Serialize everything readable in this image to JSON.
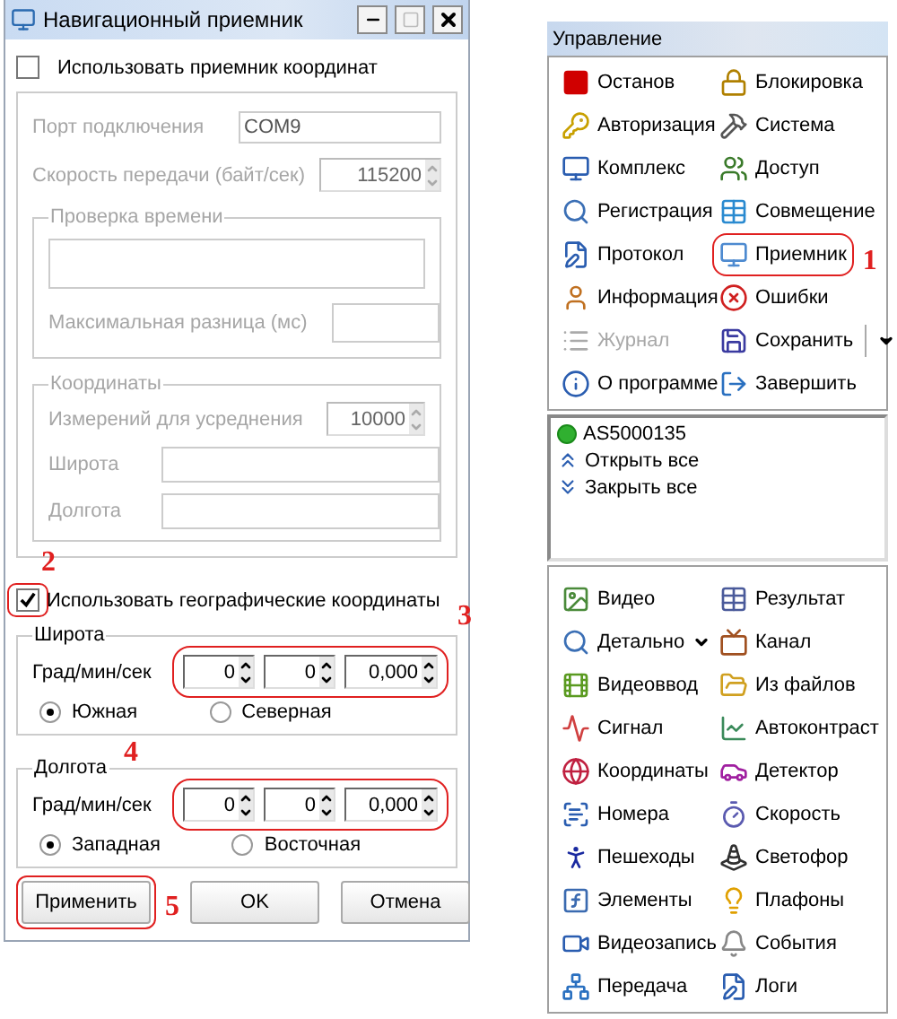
{
  "window": {
    "title": "Навигационный приемник"
  },
  "use_receiver": {
    "label": "Использовать приемник координат",
    "checked": false
  },
  "receiver": {
    "disabled": true,
    "port": {
      "label": "Порт подключения",
      "value": "COM9"
    },
    "speed": {
      "label": "Скорость передачи (байт/сек)",
      "value": "115200"
    },
    "time_check": {
      "title": "Проверка времени",
      "max_diff": {
        "label": "Максимальная разница (мс)"
      }
    },
    "coordinates": {
      "title": "Координаты",
      "averaging": {
        "label": "Измерений для усреднения",
        "value": "10000"
      },
      "latitude": {
        "label": "Широта"
      },
      "longitude": {
        "label": "Долгота"
      }
    }
  },
  "use_geo": {
    "label": "Использовать географические координаты",
    "checked": true,
    "highlighted": true,
    "callout": "2"
  },
  "geo_groups": [
    {
      "title": "Широта",
      "row_label": "Град/мин/сек",
      "spinners": [
        "0",
        "0",
        "0,000"
      ],
      "highlighted": true,
      "callout": "3",
      "options": [
        {
          "label": "Южная",
          "selected": true
        },
        {
          "label": "Северная",
          "selected": false
        }
      ]
    },
    {
      "title": "Долгота",
      "row_label": "Град/мин/сек",
      "spinners": [
        "0",
        "0",
        "0,000"
      ],
      "highlighted": true,
      "callout": "4",
      "options": [
        {
          "label": "Западная",
          "selected": true
        },
        {
          "label": "Восточная",
          "selected": false
        }
      ]
    }
  ],
  "buttons": [
    {
      "label": "Применить",
      "highlighted": true,
      "callout": "5"
    },
    {
      "label": "OK",
      "highlighted": false
    },
    {
      "label": "Отмена",
      "highlighted": false
    }
  ],
  "control_panel": {
    "title": "Управление",
    "items": [
      {
        "label": "Останов",
        "kind": "button",
        "disabled": false,
        "highlighted": false
      },
      {
        "label": "Блокировка",
        "kind": "button",
        "disabled": false,
        "highlighted": false
      },
      {
        "label": "Авторизация",
        "kind": "button",
        "disabled": false,
        "highlighted": false
      },
      {
        "label": "Система",
        "kind": "button",
        "disabled": false,
        "highlighted": false
      },
      {
        "label": "Комплекс",
        "kind": "button",
        "disabled": false,
        "highlighted": false
      },
      {
        "label": "Доступ",
        "kind": "button",
        "disabled": false,
        "highlighted": false
      },
      {
        "label": "Регистрация",
        "kind": "button",
        "disabled": false,
        "highlighted": false
      },
      {
        "label": "Совмещение",
        "kind": "button",
        "disabled": false,
        "highlighted": false
      },
      {
        "label": "Протокол",
        "kind": "button",
        "disabled": false,
        "highlighted": false
      },
      {
        "label": "Приемник",
        "kind": "button",
        "disabled": false,
        "highlighted": true,
        "callout": "1"
      },
      {
        "label": "Информация",
        "kind": "button",
        "disabled": false,
        "highlighted": false
      },
      {
        "label": "Ошибки",
        "kind": "button",
        "disabled": false,
        "highlighted": false
      },
      {
        "label": "Журнал",
        "kind": "button",
        "disabled": true,
        "highlighted": false
      },
      {
        "label": "Сохранить",
        "kind": "split",
        "disabled": false,
        "highlighted": false
      },
      {
        "label": "О программе",
        "kind": "button",
        "disabled": false,
        "highlighted": false
      },
      {
        "label": "Завершить",
        "kind": "button",
        "disabled": false,
        "highlighted": false
      }
    ]
  },
  "tree": {
    "items": [
      {
        "label": "AS5000135"
      },
      {
        "label": "Открыть все"
      },
      {
        "label": "Закрыть все"
      }
    ]
  },
  "tools": {
    "items": [
      {
        "label": "Видео",
        "kind": "button"
      },
      {
        "label": "Результат",
        "kind": "button"
      },
      {
        "label": "Детально",
        "kind": "menu"
      },
      {
        "label": "Канал",
        "kind": "button"
      },
      {
        "label": "Видеоввод",
        "kind": "button"
      },
      {
        "label": "Из файлов",
        "kind": "button"
      },
      {
        "label": "Сигнал",
        "kind": "button"
      },
      {
        "label": "Автоконтраст",
        "kind": "button"
      },
      {
        "label": "Координаты",
        "kind": "button"
      },
      {
        "label": "Детектор",
        "kind": "button"
      },
      {
        "label": "Номера",
        "kind": "button"
      },
      {
        "label": "Скорость",
        "kind": "button"
      },
      {
        "label": "Пешеходы",
        "kind": "button"
      },
      {
        "label": "Светофор",
        "kind": "button"
      },
      {
        "label": "Элементы",
        "kind": "button"
      },
      {
        "label": "Плафоны",
        "kind": "button"
      },
      {
        "label": "Видеозапись",
        "kind": "button"
      },
      {
        "label": "События",
        "kind": "button"
      },
      {
        "label": "Передача",
        "kind": "button"
      },
      {
        "label": "Логи",
        "kind": "button"
      }
    ]
  }
}
